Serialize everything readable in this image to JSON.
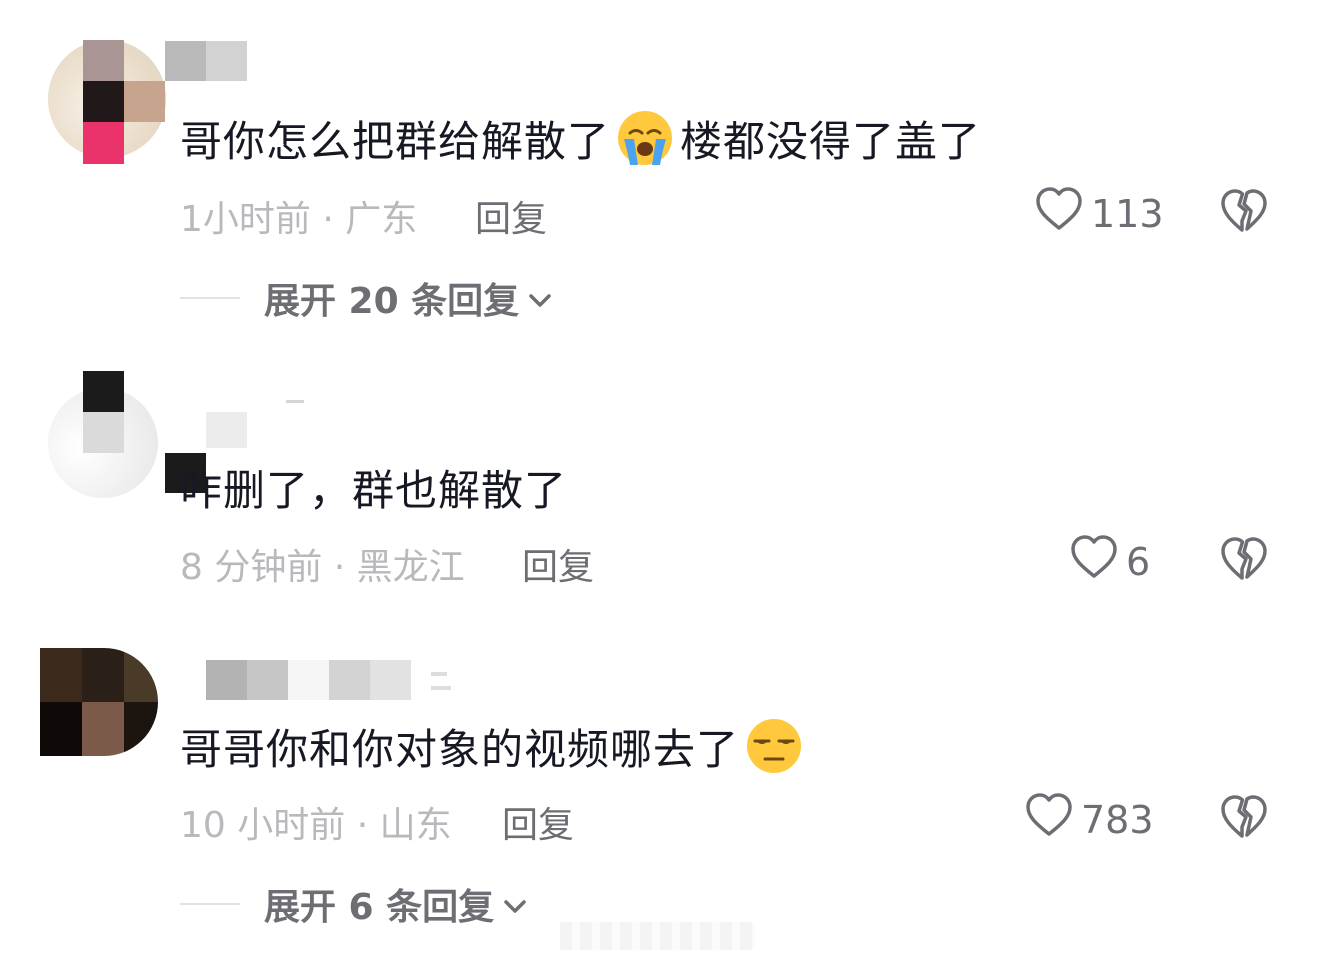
{
  "comments": [
    {
      "text_before": "哥你怎么把群给解散了",
      "emoji": "loudly-crying-face",
      "text_after": "楼都没得了盖了",
      "meta": "1小时前 · 广东",
      "reply_label": "回复",
      "like_count": "113",
      "expand_label": "展开 20 条回复"
    },
    {
      "text_before": "咋删了，群也解散了",
      "emoji": "",
      "text_after": "",
      "meta": "8 分钟前 · 黑龙江",
      "reply_label": "回复",
      "like_count": "6",
      "expand_label": ""
    },
    {
      "text_before": "哥哥你和你对象的视频哪去了",
      "emoji": "unamused-face",
      "text_after": "",
      "meta": "10 小时前 · 山东",
      "reply_label": "回复",
      "like_count": "783",
      "expand_label": "展开 6 条回复"
    }
  ],
  "colors": {
    "text": "#161823",
    "meta": "#b9b9bd",
    "secondary": "#6d6e73",
    "background": "#ffffff"
  },
  "icons": {
    "like": "heart-outline-icon",
    "dislike": "broken-heart-icon",
    "expand": "chevron-down-icon"
  }
}
